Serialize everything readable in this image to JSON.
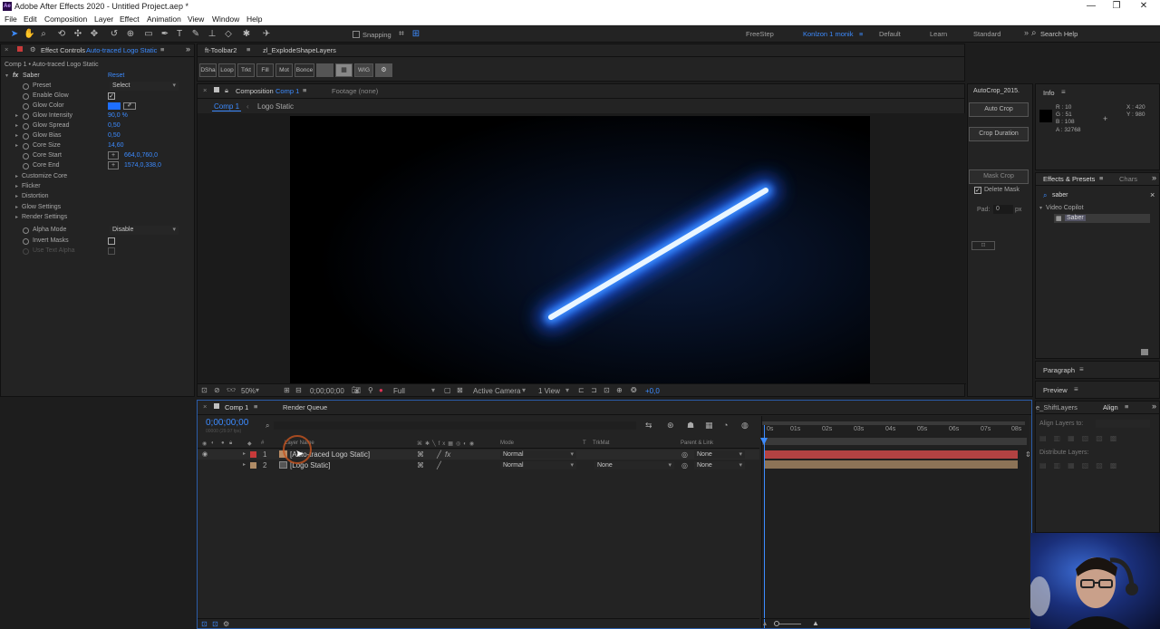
{
  "window": {
    "title": "Adobe After Effects 2020 - Untitled Project.aep *",
    "app_icon": "Ae",
    "controls": [
      "—",
      "❐",
      "✕"
    ]
  },
  "menu": [
    "File",
    "Edit",
    "Composition",
    "Layer",
    "Effect",
    "Animation",
    "View",
    "Window",
    "Help"
  ],
  "toolbar": {
    "snapping": "Snapping",
    "workspaces": [
      "FreeStep",
      "Konlzon 1 monik",
      "Default",
      "Learn",
      "Standard"
    ],
    "search_placeholder": "Search Help"
  },
  "effect_controls": {
    "tab_label": "Effect Controls",
    "layer_name": "Auto-traced Logo Static",
    "breadcrumb": "Comp 1 • Auto-traced Logo Static",
    "effect_name": "Saber",
    "reset_label": "Reset",
    "props": [
      {
        "label": "Preset",
        "type": "dropdown",
        "value": "Select"
      },
      {
        "label": "Enable Glow",
        "type": "checkbox",
        "value": "✓"
      },
      {
        "label": "Glow Color",
        "type": "color",
        "value": ""
      },
      {
        "label": "Glow Intensity",
        "type": "value",
        "value": "90,0 %"
      },
      {
        "label": "Glow Spread",
        "type": "value",
        "value": "0,50"
      },
      {
        "label": "Glow Bias",
        "type": "value",
        "value": "0,50"
      },
      {
        "label": "Core Size",
        "type": "value",
        "value": "14,60"
      },
      {
        "label": "Core Start",
        "type": "point",
        "value": "664,0,760,0"
      },
      {
        "label": "Core End",
        "type": "point",
        "value": "1574,0,338,0"
      }
    ],
    "groups": [
      "Customize Core",
      "Flicker",
      "Distortion",
      "Glow Settings",
      "Render Settings"
    ],
    "alpha_mode_label": "Alpha Mode",
    "alpha_mode_value": "Disable",
    "invert_masks_label": "Invert Masks",
    "use_text_alpha_label": "Use Text Alpha",
    "accent_color": "#3c8bff",
    "glow_color": "#1e6fff"
  },
  "ft_toolbar": {
    "tabs": [
      "ft-Toolbar2",
      "zl_ExplodeShapeLayers"
    ],
    "buttons": [
      "DSha",
      "Loop",
      "Trkt",
      "Fill",
      "Mot",
      "Bonce",
      "",
      "",
      "WIG",
      ""
    ]
  },
  "composition": {
    "tab_label": "Composition",
    "comp_name": "Comp 1",
    "footage_label": "Footage (none)",
    "breadcrumbs": [
      "Comp 1",
      "Logo Static"
    ],
    "zoom": "50%",
    "timecode": "0;00;00;00",
    "resolution": "Full",
    "camera": "Active Camera",
    "view": "1 View",
    "exposure": "+0,0"
  },
  "autocrop": {
    "title": "AutoCrop_2015.",
    "auto_crop": "Auto Crop",
    "crop_duration": "Crop Duration",
    "mask_crop": "Mask Crop",
    "delete_mask": "Delete Mask",
    "pad_label": "Pad:",
    "pad_value": "0",
    "pad_unit": "px"
  },
  "info": {
    "title": "Info",
    "r": "R : 10",
    "g": "G : 51",
    "b": "B : 108",
    "a": "A : 32768",
    "x": "X : 420",
    "y": "Y : 980"
  },
  "effects_presets": {
    "tab_label": "Effects & Presets",
    "other_tab": "Chars",
    "search_value": "saber",
    "category": "Video Copilot",
    "item": "Saber"
  },
  "side_panels": {
    "paragraph": "Paragraph",
    "preview": "Preview",
    "shift_layers": "e_ShiftLayers",
    "align": "Align",
    "align_layers_to": "Align Layers to:",
    "distribute_layers": "Distribute Layers:"
  },
  "timeline": {
    "tab_label": "Comp 1",
    "render_queue": "Render Queue",
    "timecode": "0;00;00;00",
    "fps": "00000 (29.97 fps)",
    "columns": {
      "layer_name": "Layer Name",
      "mode": "Mode",
      "t": "T",
      "trkmat": "TrkMat",
      "parent": "Parent & Link"
    },
    "layers": [
      {
        "num": "1",
        "name": "[Auto-traced Logo Static]",
        "mode": "Normal",
        "trkmat": "",
        "parent": "None",
        "label_color": "#c83a3a"
      },
      {
        "num": "2",
        "name": "[Logo Static]",
        "mode": "Normal",
        "trkmat": "None",
        "parent": "None",
        "label_color": "#b08c66"
      }
    ],
    "ruler": [
      "0s",
      "01s",
      "02s",
      "03s",
      "04s",
      "05s",
      "06s",
      "07s",
      "08s"
    ]
  }
}
